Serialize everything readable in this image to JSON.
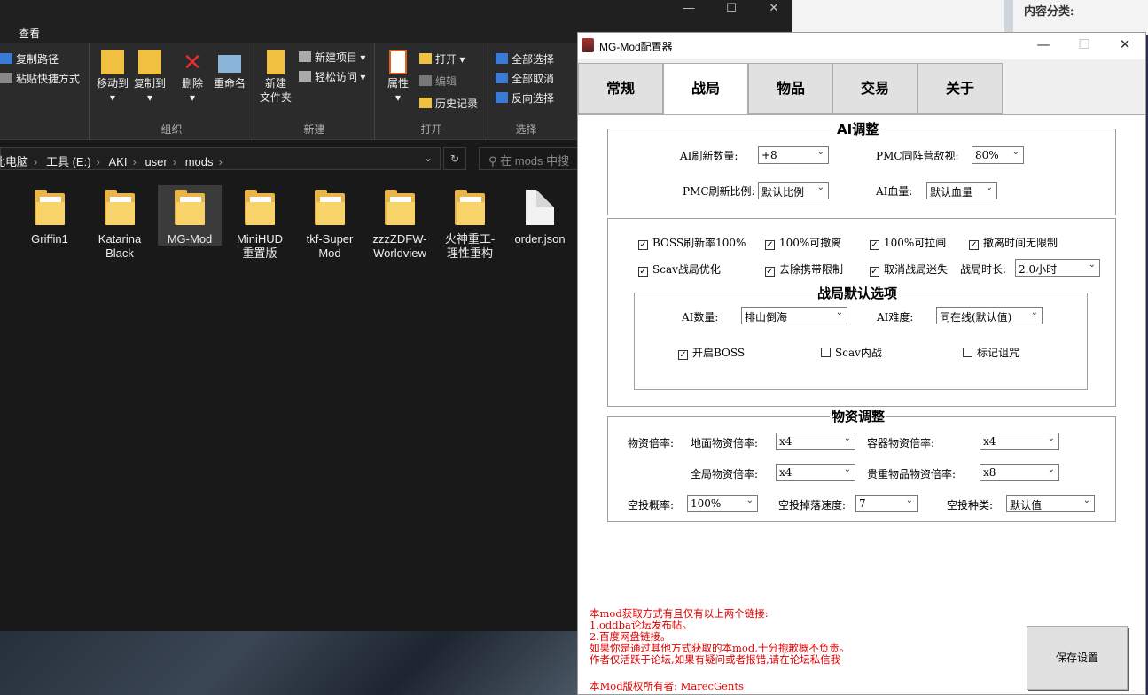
{
  "explorer": {
    "menu_tab": "查看",
    "ribbon": {
      "copy_path": "复制路径",
      "paste_shortcut": "粘贴快捷方式",
      "move_to": "移动到",
      "copy_to": "复制到",
      "delete": "删除",
      "rename": "重命名",
      "group_organize": "组织",
      "new_folder_line1": "新建",
      "new_folder_line2": "文件夹",
      "new_item": "新建项目",
      "easy_access": "轻松访问",
      "group_new": "新建",
      "properties": "属性",
      "open": "打开",
      "edit": "编辑",
      "history": "历史记录",
      "group_open": "打开",
      "select_all": "全部选择",
      "select_none": "全部取消",
      "invert_selection": "反向选择",
      "group_select": "选择"
    },
    "breadcrumb": [
      "此电脑",
      "工具 (E:)",
      "AKI",
      "user",
      "mods"
    ],
    "search_placeholder": "在 mods 中搜",
    "files": [
      {
        "line1": "Griffin1",
        "line2": "",
        "type": "folder"
      },
      {
        "line1": "Katarina",
        "line2": "Black",
        "type": "folder"
      },
      {
        "line1": "MG-Mod",
        "line2": "",
        "type": "folder"
      },
      {
        "line1": "MiniHUD",
        "line2": "重置版",
        "type": "folder"
      },
      {
        "line1": "tkf-Super",
        "line2": "Mod",
        "type": "folder"
      },
      {
        "line1": "zzzZDFW-",
        "line2": "Worldview",
        "type": "folder"
      },
      {
        "line1": "火神重工-",
        "line2": "理性重构",
        "type": "folder"
      },
      {
        "line1": "order.json",
        "line2": "",
        "type": "file"
      }
    ]
  },
  "background": {
    "category_label": "内容分类:"
  },
  "config": {
    "title": "MG-Mod配置器",
    "tabs": [
      "常规",
      "战局",
      "物品",
      "交易",
      "关于"
    ],
    "active_tab": "战局",
    "ai_section": {
      "title": "AI调整",
      "ai_refresh_label": "AI刷新数量:",
      "ai_refresh_value": "+8",
      "pmc_hostile_label": "PMC同阵营敌视:",
      "pmc_hostile_value": "80%",
      "pmc_ratio_label": "PMC刷新比例:",
      "pmc_ratio_value": "默认比例",
      "ai_health_label": "AI血量:",
      "ai_health_value": "默认血量"
    },
    "raid_options": {
      "boss_rate": "BOSS刷新率100%",
      "extract_100": "100%可撤离",
      "lever_100": "100%可拉闸",
      "no_time_limit": "撤离时间无限制",
      "scav_opt": "Scav战局优化",
      "remove_carry_limit": "去除携带限制",
      "cancel_lost": "取消战局迷失",
      "raid_time_label": "战局时长:",
      "raid_time_value": "2.0小时"
    },
    "raid_defaults": {
      "title": "战局默认选项",
      "ai_count_label": "AI数量:",
      "ai_count_value": "排山倒海",
      "ai_difficulty_label": "AI难度:",
      "ai_difficulty_value": "同在线(默认值)",
      "enable_boss": "开启BOSS",
      "scav_war": "Scav内战",
      "mark_curse": "标记诅咒"
    },
    "loot_section": {
      "title": "物资调整",
      "loot_rate_label": "物资倍率:",
      "ground_label": "地面物资倍率:",
      "ground_value": "x4",
      "container_label": "容器物资倍率:",
      "container_value": "x4",
      "global_label": "全局物资倍率:",
      "global_value": "x4",
      "valuable_label": "贵重物品物资倍率:",
      "valuable_value": "x8",
      "airdrop_chance_label": "空投概率:",
      "airdrop_chance_value": "100%",
      "airdrop_speed_label": "空投掉落速度:",
      "airdrop_speed_value": "7",
      "airdrop_type_label": "空投种类:",
      "airdrop_type_value": "默认值"
    },
    "notice": [
      "本mod获取方式有且仅有以上两个链接:",
      "1.oddba论坛发布帖。",
      "2.百度网盘链接。",
      "如果你是通过其他方式获取的本mod,十分抱歉概不负责。",
      "作者仅活跃于论坛,如果有疑问或者报错,请在论坛私信我"
    ],
    "owner": "本Mod版权所有者: MarecGents",
    "save_button": "保存设置"
  }
}
